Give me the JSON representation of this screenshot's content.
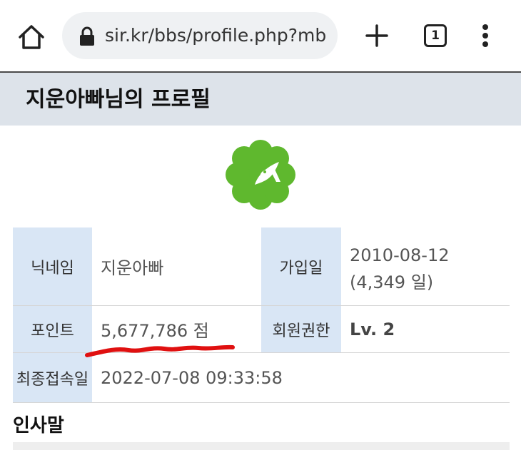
{
  "browser": {
    "url": "sir.kr/bbs/profile.php?mb",
    "tab_count": "1"
  },
  "page": {
    "title": "지운아빠님의 프로필"
  },
  "profile": {
    "nickname_label": "닉네임",
    "nickname": "지운아빠",
    "joined_label": "가입일",
    "joined_date": "2010-08-12",
    "joined_days": "(4,349 일)",
    "points_label": "포인트",
    "points": "5,677,786 점",
    "level_label": "회원권한",
    "level": "Lv. 2",
    "last_login_label": "최종접속일",
    "last_login": "2022-07-08 09:33:58"
  },
  "greeting": {
    "heading": "인사말"
  },
  "colors": {
    "avatar_green": "#5fb82e",
    "label_bg": "#d9e6f5",
    "title_bg": "#dde3ea",
    "annotation_red": "#e01010"
  }
}
